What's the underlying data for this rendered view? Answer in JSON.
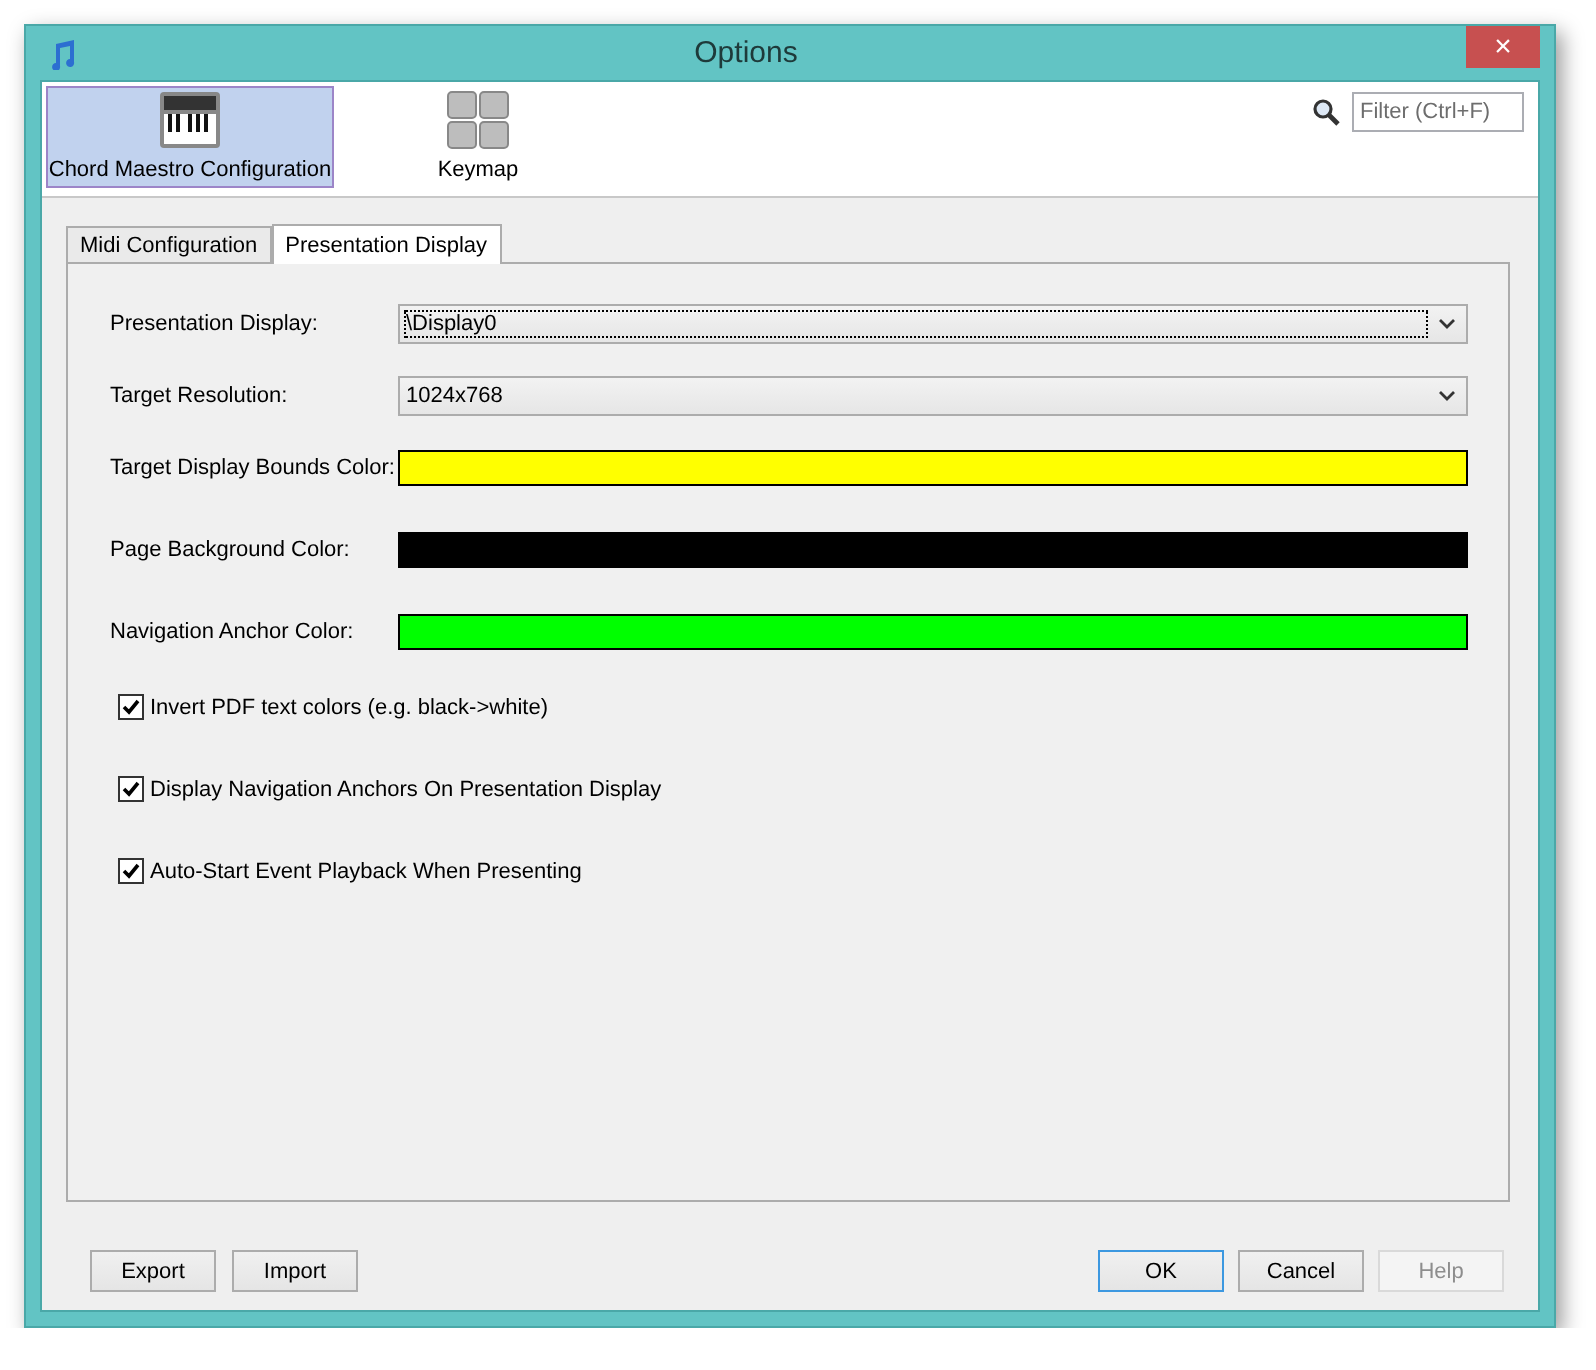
{
  "window": {
    "title": "Options",
    "close": "×"
  },
  "categories": [
    {
      "label": "Chord Maestro Configuration",
      "kind": "piano",
      "selected": true
    },
    {
      "label": "Keymap",
      "kind": "keys",
      "selected": false
    }
  ],
  "filter": {
    "placeholder": "Filter (Ctrl+F)"
  },
  "tabs": [
    {
      "label": "Midi Configuration",
      "selected": false
    },
    {
      "label": "Presentation Display",
      "selected": true
    }
  ],
  "settings": [
    {
      "kind": "combo",
      "label": "Presentation Display:",
      "value": "\\Display0",
      "focused": true
    },
    {
      "kind": "combo",
      "label": "Target Resolution:",
      "value": "1024x768",
      "focused": false
    },
    {
      "kind": "color",
      "label": "Target Display Bounds Color:",
      "color": "#ffff00"
    },
    {
      "kind": "color",
      "label": "Page Background Color:",
      "color": "#000000"
    },
    {
      "kind": "color",
      "label": "Navigation Anchor Color:",
      "color": "#00ff00"
    }
  ],
  "options": [
    {
      "label": "Invert PDF text colors (e.g. black->white)",
      "checked": true
    },
    {
      "label": "Display Navigation Anchors On Presentation Display",
      "checked": true
    },
    {
      "label": "Auto-Start Event Playback When Presenting",
      "checked": true
    }
  ],
  "left_buttons": [
    {
      "label": "Export",
      "default": false,
      "disabled": false
    },
    {
      "label": "Import",
      "default": false,
      "disabled": false
    }
  ],
  "right_buttons": [
    {
      "label": "OK",
      "default": true,
      "disabled": false
    },
    {
      "label": "Cancel",
      "default": false,
      "disabled": false
    },
    {
      "label": "Help",
      "default": false,
      "disabled": true
    }
  ]
}
